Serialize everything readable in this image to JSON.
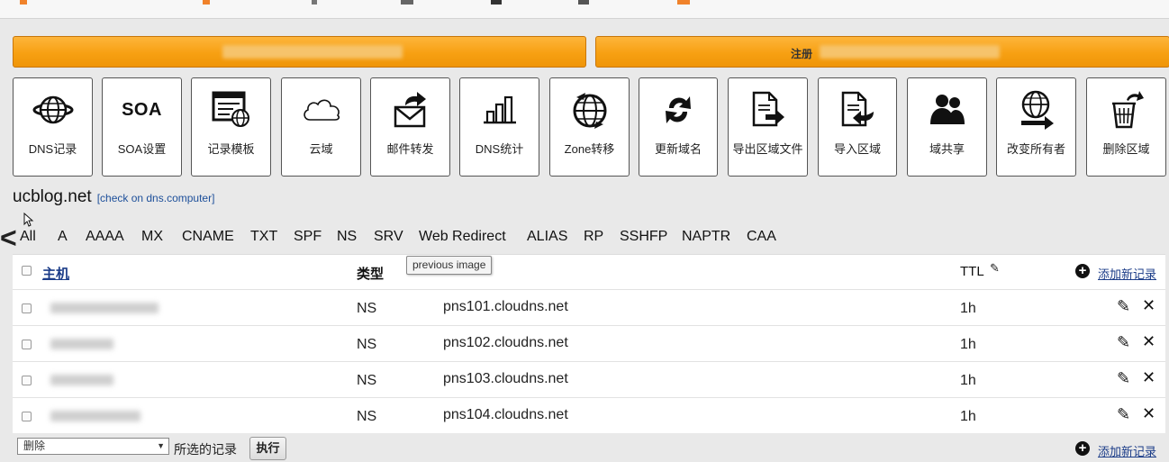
{
  "actions": {
    "bar_left_label": "",
    "bar_right_label": "注册"
  },
  "tools": [
    {
      "label": "DNS记录",
      "icon": "globe-icon"
    },
    {
      "label": "SOA设置",
      "icon": "soa-text-icon",
      "icon_text": "SOA"
    },
    {
      "label": "记录模板",
      "icon": "template-icon"
    },
    {
      "label": "云域",
      "icon": "cloud-icon"
    },
    {
      "label": "邮件转发",
      "icon": "mail-forward-icon"
    },
    {
      "label": "DNS统计",
      "icon": "bar-chart-icon"
    },
    {
      "label": "Zone转移",
      "icon": "globe-transfer-icon"
    },
    {
      "label": "更新域名",
      "icon": "refresh-icon"
    },
    {
      "label": "导出区域文件",
      "icon": "export-file-icon"
    },
    {
      "label": "导入区域",
      "icon": "import-file-icon"
    },
    {
      "label": "域共享",
      "icon": "users-icon"
    },
    {
      "label": "改变所有者",
      "icon": "globe-arrow-icon"
    },
    {
      "label": "删除区域",
      "icon": "trash-icon"
    }
  ],
  "domain": {
    "name": "ucblog.net",
    "check_link": "[check on dns.computer]"
  },
  "nav": {
    "back_symbol": "<"
  },
  "tabs": [
    "All",
    "A",
    "AAAA",
    "MX",
    "CNAME",
    "TXT",
    "SPF",
    "NS",
    "SRV",
    "Web Redirect",
    "ALIAS",
    "RP",
    "SSHFP",
    "NAPTR",
    "CAA"
  ],
  "tooltip": "previous image",
  "table": {
    "headers": {
      "host": "主机",
      "type": "类型",
      "ttl": "TTL",
      "add_record": "添加新记录"
    },
    "rows": [
      {
        "type": "NS",
        "value": "pns101.cloudns.net",
        "ttl": "1h"
      },
      {
        "type": "NS",
        "value": "pns102.cloudns.net",
        "ttl": "1h"
      },
      {
        "type": "NS",
        "value": "pns103.cloudns.net",
        "ttl": "1h"
      },
      {
        "type": "NS",
        "value": "pns104.cloudns.net",
        "ttl": "1h"
      }
    ]
  },
  "footer": {
    "bulk_action_selected": "删除",
    "selected_label": "所选的记录",
    "execute_label": "执行",
    "add_record": "添加新记录"
  },
  "colors": {
    "accent_orange": "#f7a012",
    "link_blue": "#1b3c88"
  }
}
